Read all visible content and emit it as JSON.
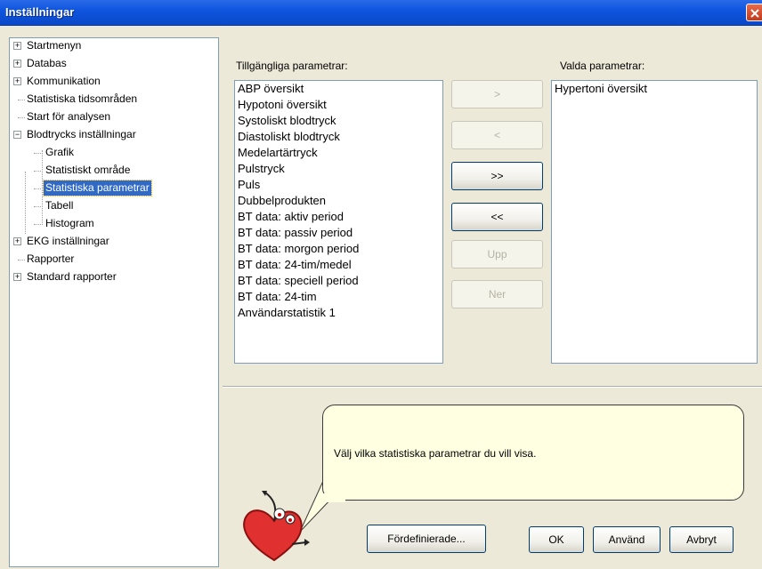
{
  "window": {
    "title": "Inställningar"
  },
  "tree": {
    "items": [
      {
        "label": "Startmenyn",
        "expander": "+"
      },
      {
        "label": "Databas",
        "expander": "+"
      },
      {
        "label": "Kommunikation",
        "expander": "+"
      },
      {
        "label": "Statistiska tidsområden"
      },
      {
        "label": "Start för analysen"
      },
      {
        "label": "Blodtrycks inställningar",
        "expander": "−"
      },
      {
        "label": "Grafik"
      },
      {
        "label": "Statistiskt område"
      },
      {
        "label": "Statistiska parametrar",
        "selected": true
      },
      {
        "label": "Tabell"
      },
      {
        "label": "Histogram"
      },
      {
        "label": "EKG inställningar",
        "expander": "+"
      },
      {
        "label": "Rapporter"
      },
      {
        "label": "Standard rapporter",
        "expander": "+"
      }
    ]
  },
  "available": {
    "label": "Tillgängliga parametrar:",
    "items": [
      "ABP översikt",
      "Hypotoni översikt",
      "Systoliskt blodtryck",
      "Diastoliskt blodtryck",
      "Medelartärtryck",
      "Pulstryck",
      "Puls",
      "Dubbelprodukten",
      "BT data: aktiv period",
      "BT data: passiv period",
      "BT data: morgon period",
      "BT data: 24-tim/medel",
      "BT data: speciell period",
      "BT data: 24-tim",
      "Användarstatistik 1"
    ]
  },
  "chosen": {
    "label": "Valda parametrar:",
    "items": [
      "Hypertoni översikt"
    ]
  },
  "buttons": {
    "add": ">",
    "remove": "<",
    "add_all": ">>",
    "remove_all": "<<",
    "up": "Upp",
    "down": "Ner",
    "predefined": "Fördefinierade...",
    "ok": "OK",
    "apply": "Använd",
    "cancel": "Avbryt"
  },
  "help": {
    "text": "Välj vilka statistiska parametrar du vill visa."
  },
  "colors": {
    "selection": "#316ac5",
    "bubble": "#ffffe1",
    "titlebar": "#0f55df"
  }
}
